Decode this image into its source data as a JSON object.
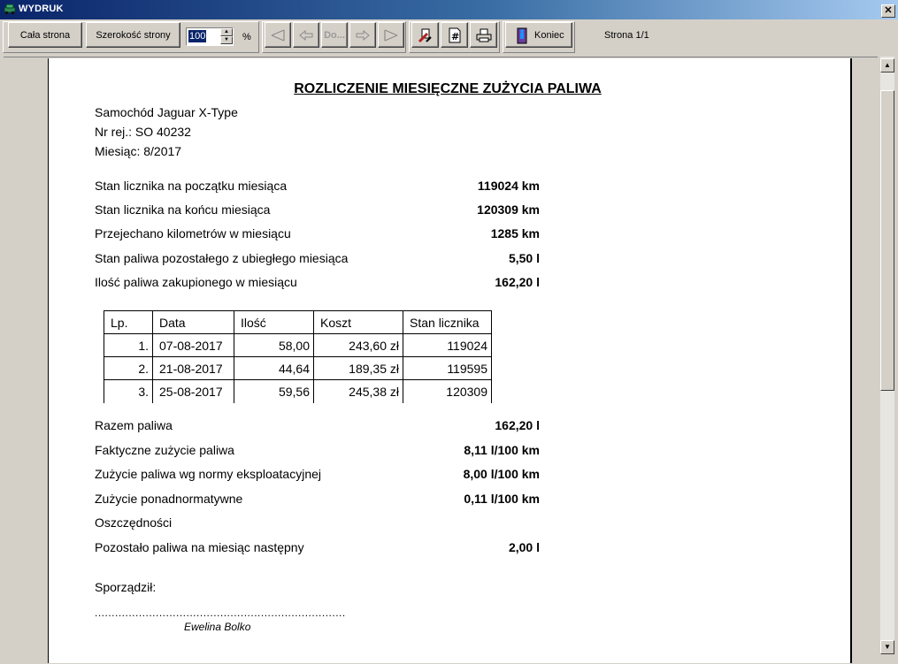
{
  "window": {
    "title": "WYDRUK",
    "close_glyph": "✕"
  },
  "toolbar": {
    "full_page_label": "Cała strona",
    "page_width_label": "Szerokość strony",
    "zoom_value": "100",
    "zoom_unit": "%",
    "goto_label": "Do...",
    "end_label": "Koniec",
    "page_indicator": "Strona 1/1"
  },
  "document": {
    "title": "ROZLICZENIE MIESIĘCZNE ZUŻYCIA PALIWA",
    "car": "Samochód Jaguar X-Type",
    "registration": "Nr rej.:  SO 40232",
    "month": "Miesiąc:  8/2017",
    "summary_top": [
      {
        "label": "Stan licznika na początku miesiąca",
        "value": "119024 km"
      },
      {
        "label": "Stan licznika na końcu miesiąca",
        "value": "120309 km"
      },
      {
        "label": "Przejechano kilometrów w miesiącu",
        "value": "1285 km"
      },
      {
        "label": "Stan paliwa pozostałego z ubiegłego miesiąca",
        "value": "5,50 l"
      },
      {
        "label": "Ilość paliwa zakupionego w miesiącu",
        "value": "162,20 l"
      }
    ],
    "table_headers": [
      "Lp.",
      "Data",
      "Ilość",
      "Koszt",
      "Stan licznika"
    ],
    "table_rows": [
      [
        "1.",
        "07-08-2017",
        "58,00",
        "243,60 zł",
        "119024"
      ],
      [
        "2.",
        "21-08-2017",
        "44,64",
        "189,35 zł",
        "119595"
      ],
      [
        "3.",
        "25-08-2017",
        "59,56",
        "245,38 zł",
        "120309"
      ]
    ],
    "summary_bottom": [
      {
        "label": "Razem paliwa",
        "value": "162,20 l"
      },
      {
        "label": "Faktyczne zużycie paliwa",
        "value": "8,11 l/100 km"
      },
      {
        "label": "Zużycie paliwa wg normy eksploatacyjnej",
        "value": "8,00 l/100 km"
      },
      {
        "label": "Zużycie ponadnormatywne",
        "value": "0,11 l/100 km"
      },
      {
        "label": "Oszczędności",
        "value": ""
      },
      {
        "label": "Pozostało paliwa na miesiąc następny",
        "value": "2,00 l"
      }
    ],
    "prepared_by_label": "Sporządził:",
    "signature_line": "..........................................................................",
    "signer": "Ewelina Bolko"
  },
  "colors": {
    "titlebar_start": "#0a246a",
    "titlebar_end": "#a6caf0",
    "chrome": "#d4d0c8"
  }
}
